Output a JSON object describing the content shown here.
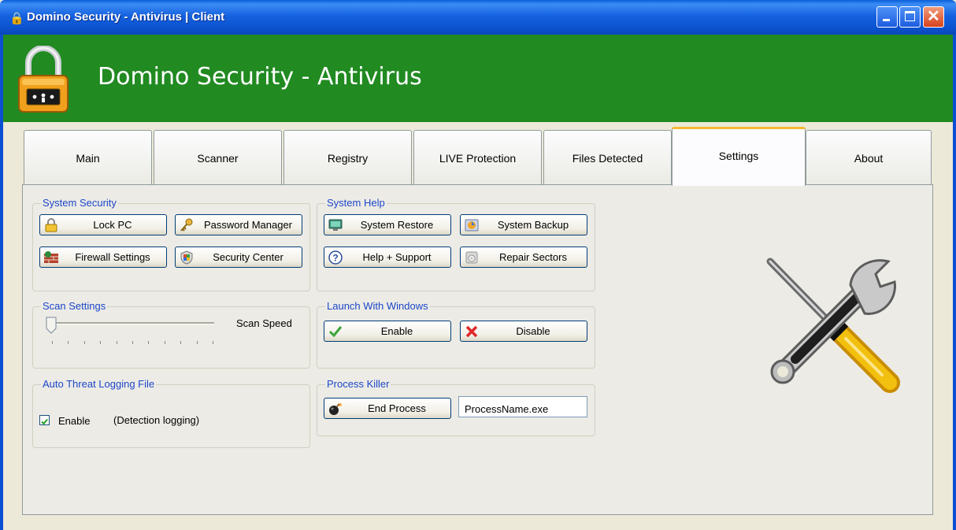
{
  "window": {
    "title": "Domino Security - Antivirus | Client",
    "controls": {
      "minimize": "minimize",
      "maximize": "maximize",
      "close": "close",
      "close_glyph": "✕"
    }
  },
  "header": {
    "app_title": "Domino Security - Antivirus",
    "logo_icon": "padlock-icon"
  },
  "tabs": [
    {
      "label": "Main"
    },
    {
      "label": "Scanner"
    },
    {
      "label": "Registry"
    },
    {
      "label": "LIVE Protection"
    },
    {
      "label": "Files Detected"
    },
    {
      "label": "Settings",
      "active": true
    },
    {
      "label": "About"
    }
  ],
  "system_security": {
    "title": "System Security",
    "lock_pc": "Lock PC",
    "password_manager": "Password Manager",
    "firewall_settings": "Firewall Settings",
    "security_center": "Security Center"
  },
  "system_help": {
    "title": "System Help",
    "system_restore": "System Restore",
    "system_backup": "System Backup",
    "help_support": "Help + Support",
    "repair_sectors": "Repair Sectors"
  },
  "scan_settings": {
    "title": "Scan Settings",
    "label": "Scan Speed",
    "speed_value": 0
  },
  "launch_with_windows": {
    "title": "Launch With Windows",
    "enable": "Enable",
    "disable": "Disable"
  },
  "auto_threat_logging": {
    "title": "Auto Threat Logging File",
    "checkbox_label": "Enable",
    "note": "(Detection logging)",
    "checked": true
  },
  "process_killer": {
    "title": "Process Killer",
    "end_process": "End Process",
    "process_name": "ProcessName.exe"
  },
  "colors": {
    "header_green": "#218a21",
    "legend_blue": "#1d47c8",
    "active_tab_accent": "#f7b933"
  }
}
